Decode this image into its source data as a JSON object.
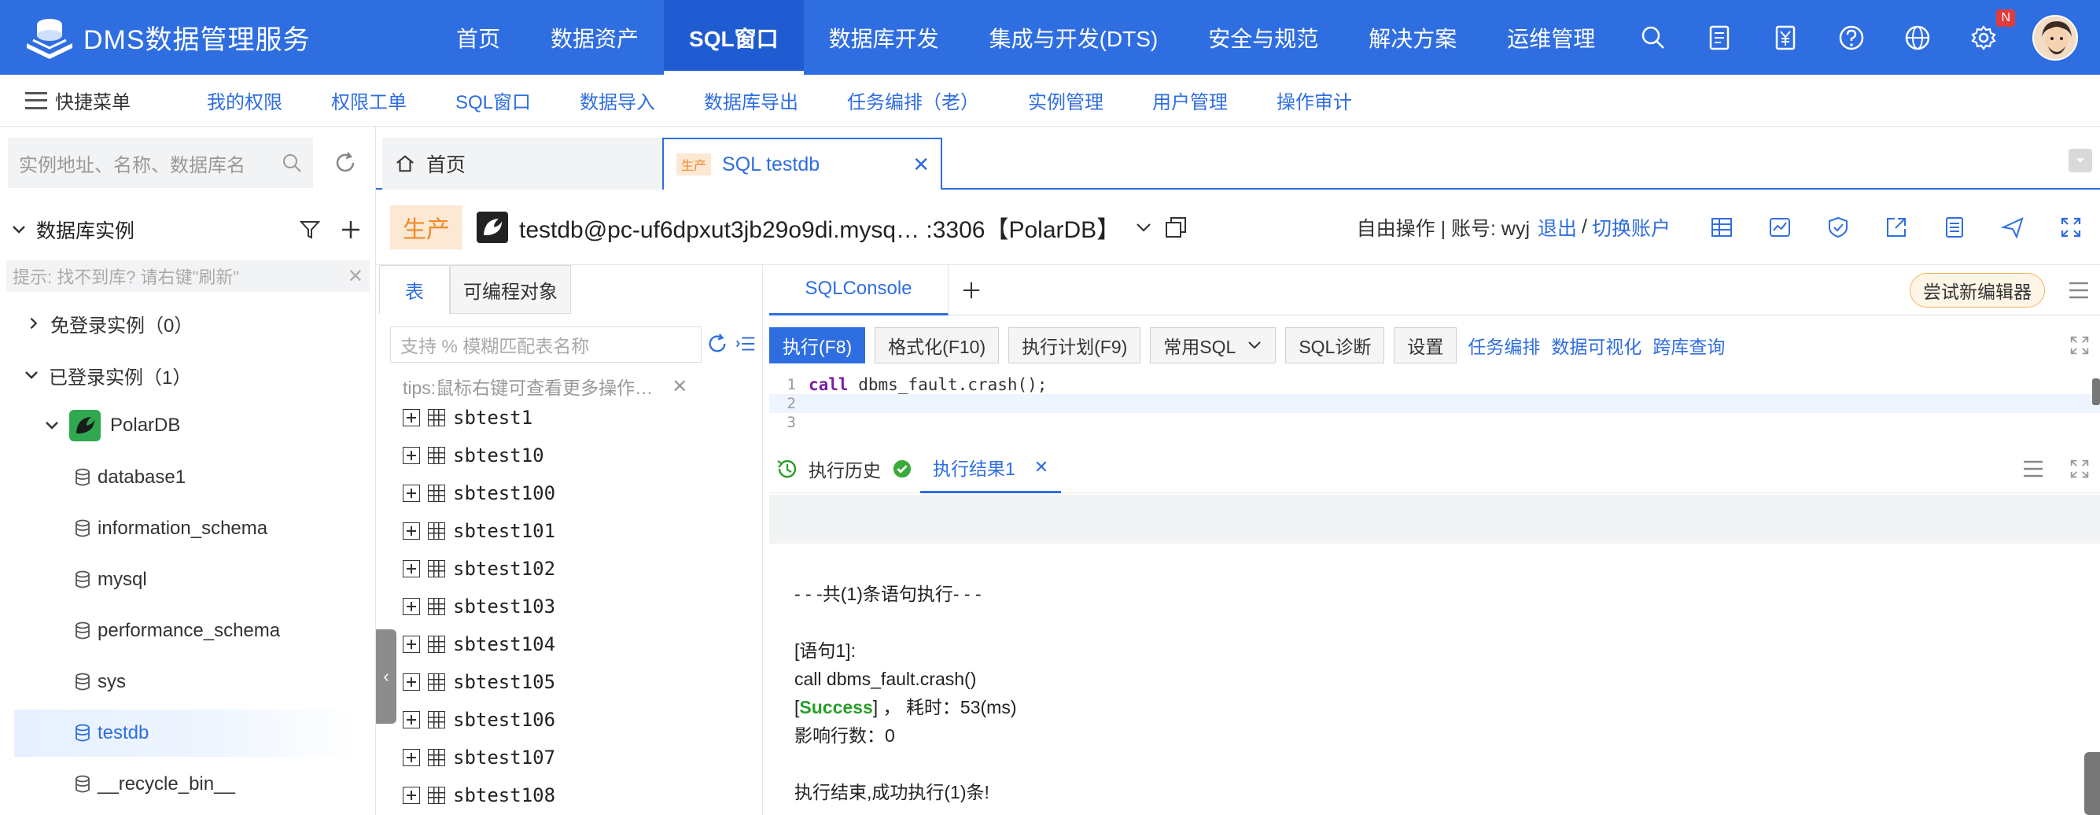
{
  "app": {
    "title": "DMS数据管理服务"
  },
  "nav": {
    "items": [
      "首页",
      "数据资产",
      "SQL窗口",
      "数据库开发",
      "集成与开发(DTS)",
      "安全与规范",
      "解决方案",
      "运维管理"
    ],
    "active_index": 2,
    "badge": "N"
  },
  "subnav": {
    "quick_menu": "快捷菜单",
    "links": [
      "我的权限",
      "权限工单",
      "SQL窗口",
      "数据导入",
      "数据库导出",
      "任务编排（老）",
      "实例管理",
      "用户管理",
      "操作审计"
    ]
  },
  "sidebar": {
    "search_placeholder": "实例地址、名称、数据库名",
    "section_title": "数据库实例",
    "hint": "提示: 找不到库? 请右键\"刷新\"",
    "groups": {
      "no_login": "免登录实例（0）",
      "logged_in": "已登录实例（1）"
    },
    "instance": "PolarDB",
    "databases": [
      "database1",
      "information_schema",
      "mysql",
      "performance_schema",
      "sys",
      "testdb",
      "__recycle_bin__"
    ],
    "selected_db": "testdb"
  },
  "tabs": {
    "home": "首页",
    "sql_tag": "生产",
    "sql_label": "SQL testdb"
  },
  "connection": {
    "env": "生产",
    "title": "testdb@pc-uf6dpxut3jb29o9di.mysq… :3306【PolarDB】",
    "mode": "自由操作 | 账号: wyj",
    "logout": "退出",
    "switch": "切换账户",
    "sep": "/"
  },
  "table_panel": {
    "tabs": [
      "表",
      "可编程对象"
    ],
    "search_placeholder": "支持 % 模糊匹配表名称",
    "tips": "tips:鼠标右键可查看更多操作…",
    "tables": [
      "sbtest1",
      "sbtest10",
      "sbtest100",
      "sbtest101",
      "sbtest102",
      "sbtest103",
      "sbtest104",
      "sbtest105",
      "sbtest106",
      "sbtest107",
      "sbtest108"
    ]
  },
  "editor": {
    "tab": "SQLConsole",
    "try_new": "尝试新编辑器",
    "toolbar": {
      "run": "执行(F8)",
      "format": "格式化(F10)",
      "plan": "执行计划(F9)",
      "common_sql": "常用SQL",
      "diagnose": "SQL诊断",
      "settings": "设置",
      "links": [
        "任务编排",
        "数据可视化",
        "跨库查询"
      ]
    },
    "code": {
      "line_numbers": [
        "1",
        "2",
        "3"
      ],
      "keyword": "call",
      "rest": " dbms_fault.crash();"
    },
    "result_tabs": {
      "history": "执行历史",
      "result": "执行结果1"
    },
    "result": {
      "summary": "- - -共(1)条语句执行- - -",
      "stmt_label": "[语句1]:",
      "stmt": "call dbms_fault.crash()",
      "status_open": "[",
      "status": "Success",
      "status_close": "] ，  耗时：53(ms)",
      "rows": "影响行数：0",
      "done": "执行结束,成功执行(1)条!"
    }
  },
  "colors": {
    "primary": "#2f6ee0",
    "prod": "#f08a2b",
    "success": "#2a9d2a"
  }
}
